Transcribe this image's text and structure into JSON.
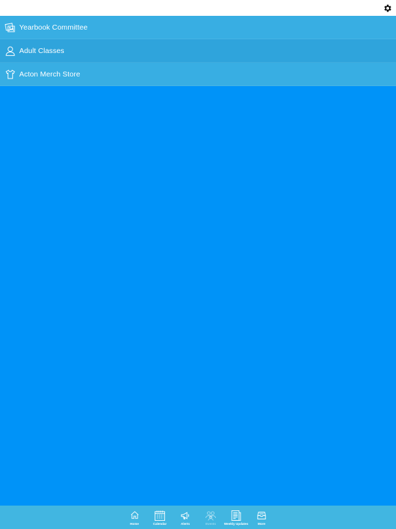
{
  "header": {
    "settings_icon": "gear-icon"
  },
  "list": [
    {
      "label": "Yearbook Committee",
      "icon": "photos-icon",
      "bg": "#38aee3"
    },
    {
      "label": "Adult Classes",
      "icon": "user-icon",
      "bg": "#2fa4dc"
    },
    {
      "label": "Acton Merch Store",
      "icon": "tshirt-icon",
      "bg": "#38aee3"
    }
  ],
  "tabbar": {
    "tabs": [
      {
        "label": "Home",
        "icon": "home-icon"
      },
      {
        "label": "Calendar",
        "icon": "calendar-icon"
      },
      {
        "label": "Alerts",
        "icon": "megaphone-icon"
      },
      {
        "label": "Events",
        "icon": "people-icon"
      },
      {
        "label": "Weekly Updates",
        "icon": "document-icon"
      },
      {
        "label": "More",
        "icon": "tray-icon"
      }
    ]
  },
  "colors": {
    "main_bg": "#0093f8",
    "tabbar_bg": "#41b6e1"
  }
}
